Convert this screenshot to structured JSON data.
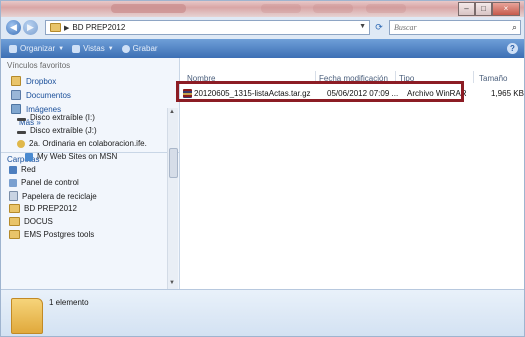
{
  "address": {
    "crumb": "BD PREP2012"
  },
  "search": {
    "placeholder": "Buscar"
  },
  "toolbar": {
    "organize": "Organizar",
    "views": "Vistas",
    "burn": "Grabar"
  },
  "left_pane": {
    "favorites_heading": "Vínculos favoritos",
    "favorites": [
      "Dropbox",
      "Documentos",
      "Imágenes"
    ],
    "more": "Más",
    "folders_heading": "Carpetas",
    "tree": [
      "Disco extraíble (I:)",
      "Disco extraíble (J:)",
      "2a. Ordinaria en colaboracion.ife.",
      "My Web Sites on MSN",
      "Red",
      "Panel de control",
      "Papelera de reciclaje",
      "BD PREP2012",
      "DOCUS",
      "EMS Postgres tools"
    ]
  },
  "columns": [
    "Nombre",
    "Fecha modificación",
    "Tipo",
    "Tamaño"
  ],
  "files": [
    {
      "name": "20120605_1315-listaActas.tar.gz",
      "modified": "05/06/2012 07:09 ...",
      "type": "Archivo WinRAR",
      "size": "1,965 KB"
    }
  ],
  "details": {
    "count": "1 elemento"
  },
  "colors": {
    "highlight": "#8c1c24",
    "toolbar": "#3c6fb4",
    "link": "#1a4f9a"
  }
}
